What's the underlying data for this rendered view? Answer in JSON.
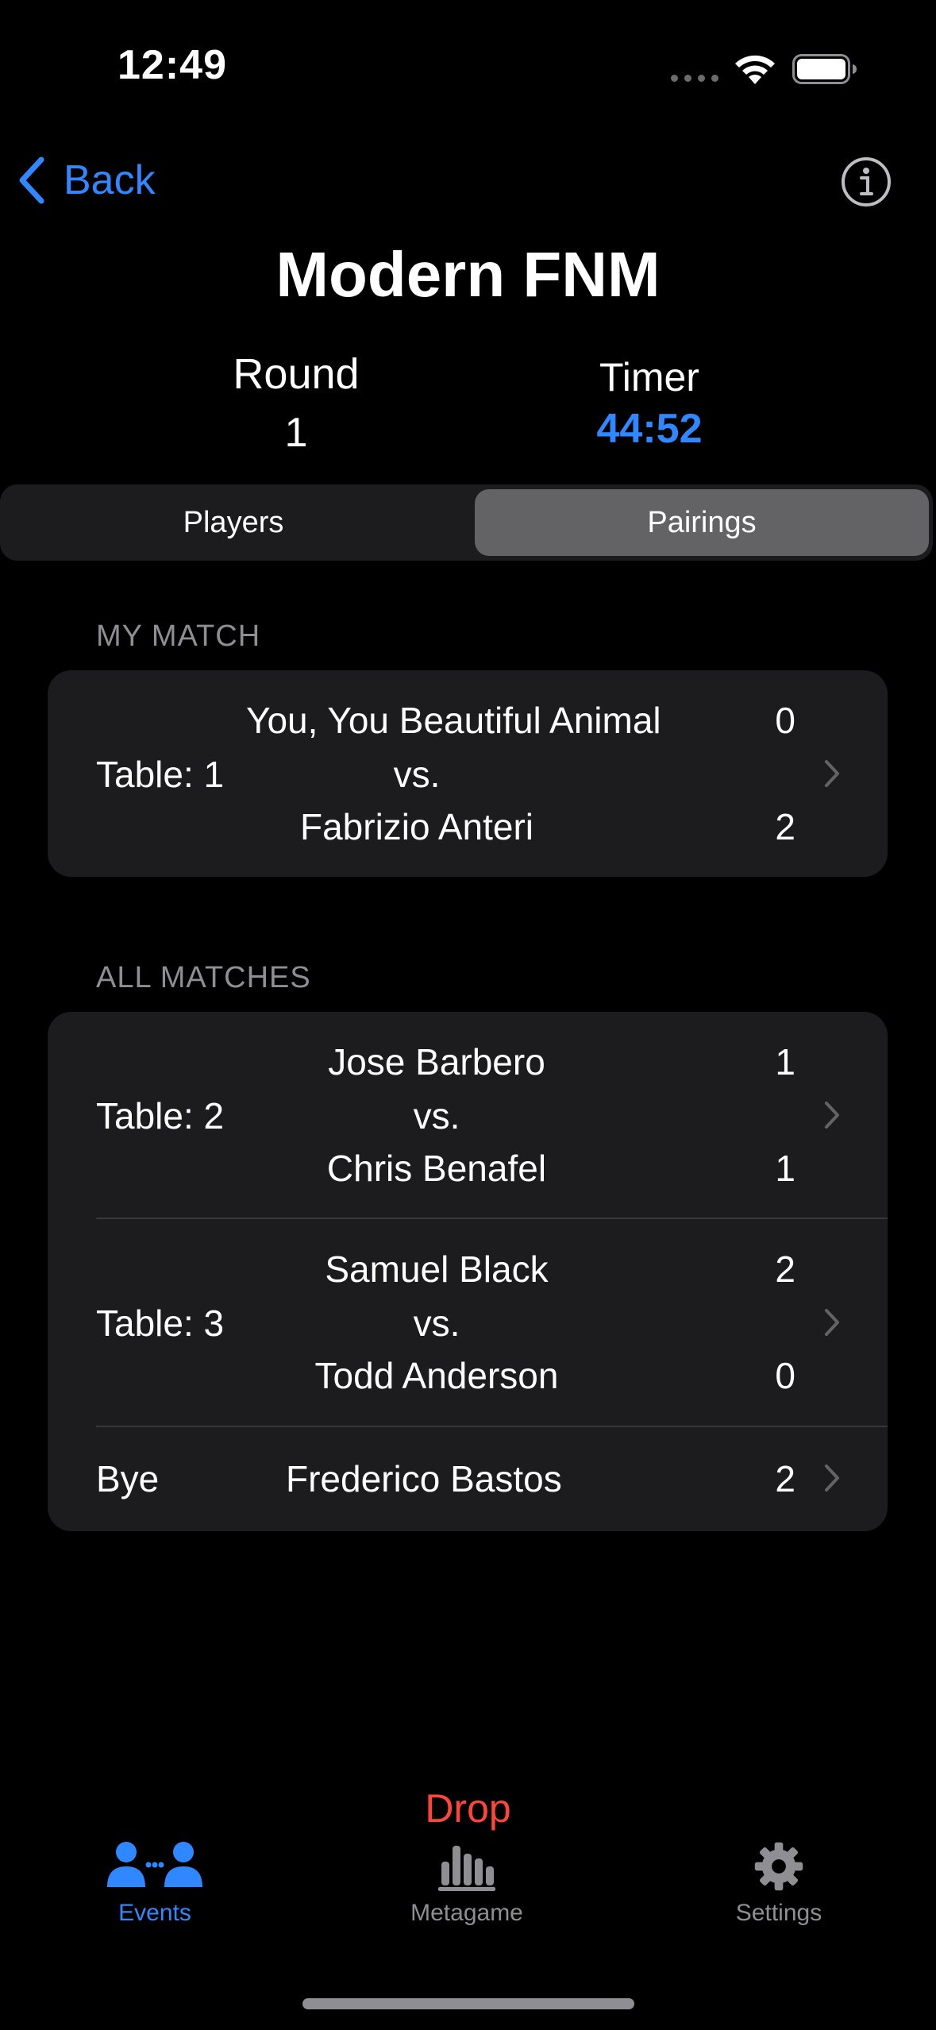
{
  "status_bar": {
    "time": "12:49"
  },
  "nav": {
    "back_label": "Back"
  },
  "event": {
    "title": "Modern FNM",
    "round_label": "Round",
    "round_value": "1",
    "timer_label": "Timer",
    "timer_value": "44:52"
  },
  "segments": {
    "players": "Players",
    "pairings": "Pairings",
    "selected": "Pairings"
  },
  "my_match": {
    "header": "MY MATCH",
    "table": "Table: 1",
    "player1": "You, You Beautiful Animal",
    "vs": "vs.",
    "player2": "Fabrizio Anteri",
    "score1": "0",
    "score2": "2"
  },
  "all_matches": {
    "header": "ALL MATCHES",
    "rows": [
      {
        "table": "Table: 2",
        "player1": "Jose Barbero",
        "vs": "vs.",
        "player2": "Chris Benafel",
        "score1": "1",
        "score2": "1"
      },
      {
        "table": "Table: 3",
        "player1": "Samuel Black",
        "vs": "vs.",
        "player2": "Todd Anderson",
        "score1": "2",
        "score2": "0"
      }
    ],
    "bye": {
      "label": "Bye",
      "player": "Frederico Bastos",
      "score": "2"
    }
  },
  "drop_label": "Drop",
  "tabs": {
    "events": "Events",
    "metagame": "Metagame",
    "settings": "Settings",
    "active": "Events"
  },
  "colors": {
    "accent": "#2f88ff",
    "destructive": "#ff453a",
    "background": "#000000",
    "card": "#1c1c1e"
  }
}
